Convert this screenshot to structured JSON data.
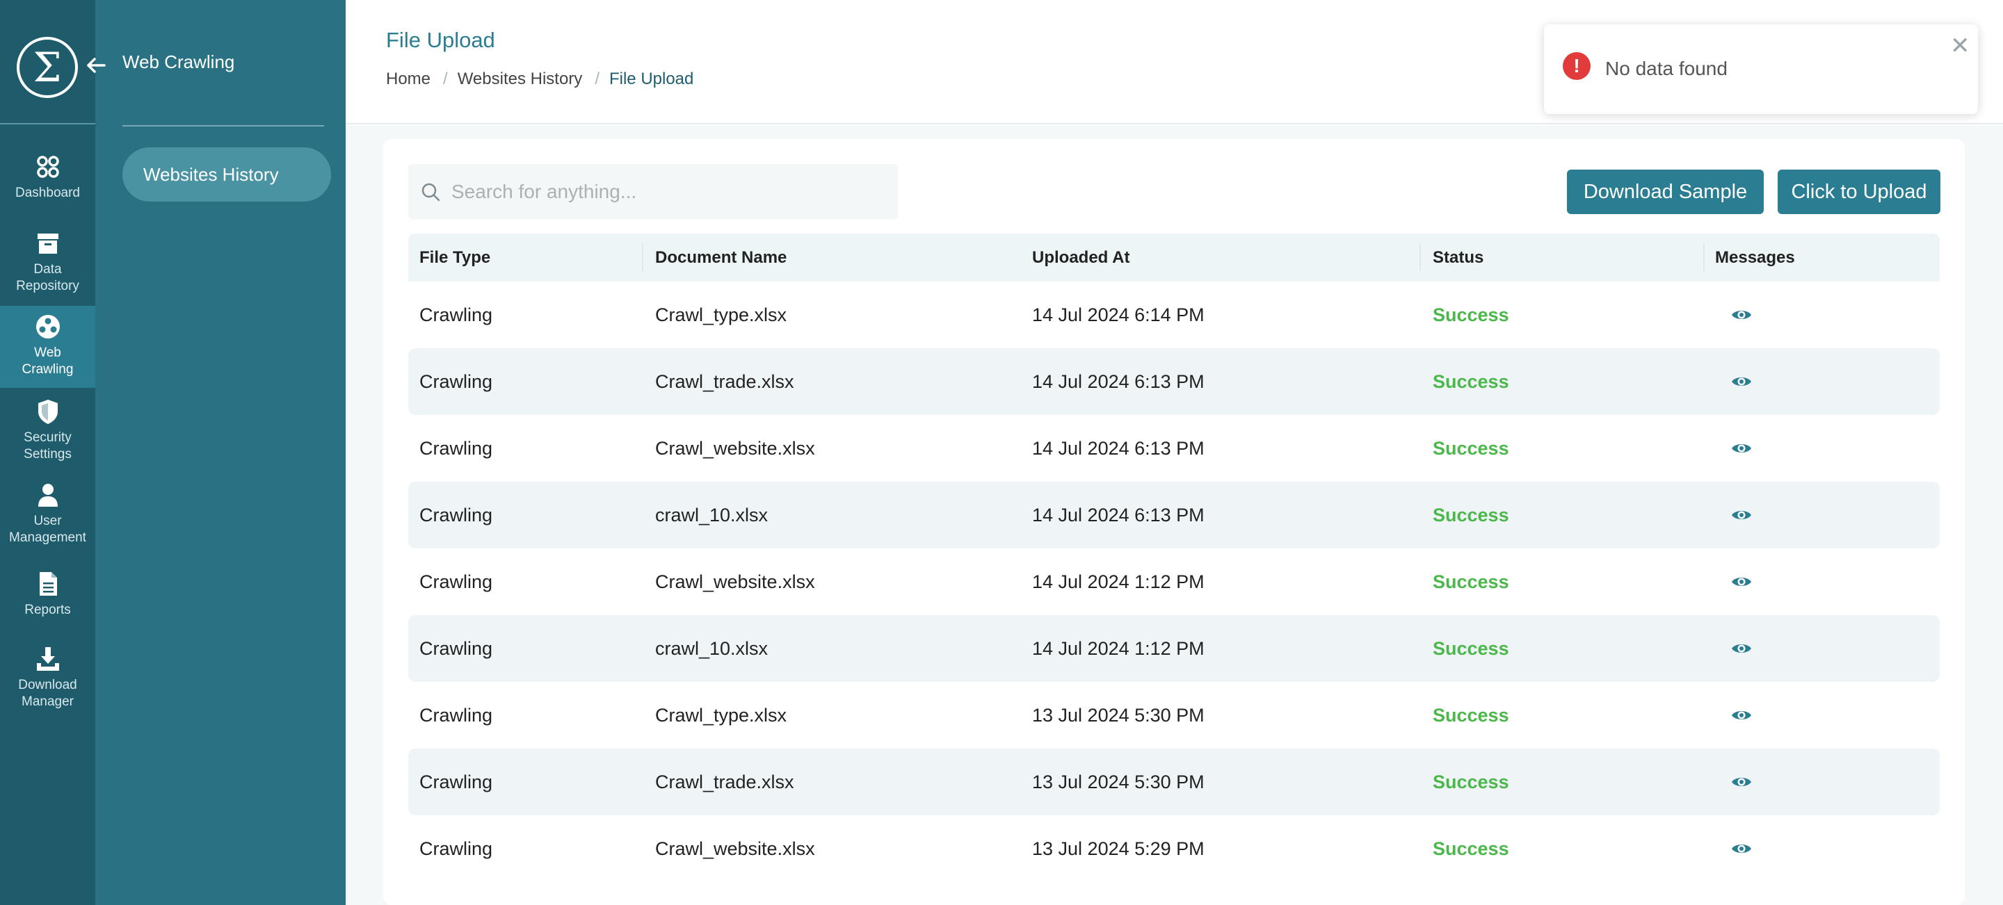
{
  "rail": {
    "logo": "Σ",
    "items": [
      {
        "label": "Dashboard",
        "icon": "dashboard-icon",
        "active": false
      },
      {
        "label": "Data Repository",
        "icon": "archive-icon",
        "active": false
      },
      {
        "label": "Web Crawling",
        "icon": "globe-icon",
        "active": true
      },
      {
        "label": "Security Settings",
        "icon": "shield-icon",
        "active": false
      },
      {
        "label": "User Management",
        "icon": "user-icon",
        "active": false
      },
      {
        "label": "Reports",
        "icon": "document-icon",
        "active": false
      },
      {
        "label": "Download Manager",
        "icon": "download-icon",
        "active": false
      }
    ]
  },
  "subnav": {
    "title": "Web Crawling",
    "items": [
      {
        "label": "Websites History"
      }
    ]
  },
  "header": {
    "title": "File Upload",
    "breadcrumb": [
      "Home",
      "Websites History",
      "File Upload"
    ]
  },
  "toast": {
    "message": "No data found",
    "icon": "error-icon",
    "color": "#e23b3b"
  },
  "toolbar": {
    "search_placeholder": "Search for anything...",
    "download_sample_label": "Download Sample",
    "upload_label": "Click to Upload"
  },
  "table": {
    "columns": [
      "File Type",
      "Document Name",
      "Uploaded At",
      "Status",
      "Messages"
    ],
    "rows": [
      {
        "type": "Crawling",
        "name": "Crawl_type.xlsx",
        "uploaded": "14 Jul 2024 6:14 PM",
        "status": "Success"
      },
      {
        "type": "Crawling",
        "name": "Crawl_trade.xlsx",
        "uploaded": "14 Jul 2024 6:13 PM",
        "status": "Success"
      },
      {
        "type": "Crawling",
        "name": "Crawl_website.xlsx",
        "uploaded": "14 Jul 2024 6:13 PM",
        "status": "Success"
      },
      {
        "type": "Crawling",
        "name": "crawl_10.xlsx",
        "uploaded": "14 Jul 2024 6:13 PM",
        "status": "Success"
      },
      {
        "type": "Crawling",
        "name": "Crawl_website.xlsx",
        "uploaded": "14 Jul 2024 1:12 PM",
        "status": "Success"
      },
      {
        "type": "Crawling",
        "name": "crawl_10.xlsx",
        "uploaded": "14 Jul 2024 1:12 PM",
        "status": "Success"
      },
      {
        "type": "Crawling",
        "name": "Crawl_type.xlsx",
        "uploaded": "13 Jul 2024 5:30 PM",
        "status": "Success"
      },
      {
        "type": "Crawling",
        "name": "Crawl_trade.xlsx",
        "uploaded": "13 Jul 2024 5:30 PM",
        "status": "Success"
      },
      {
        "type": "Crawling",
        "name": "Crawl_website.xlsx",
        "uploaded": "13 Jul 2024 5:29 PM",
        "status": "Success"
      }
    ]
  },
  "colors": {
    "rail": "#1e5b6b",
    "subnav": "#2a7183",
    "accent": "#2b7d91",
    "success": "#4cb84c"
  }
}
